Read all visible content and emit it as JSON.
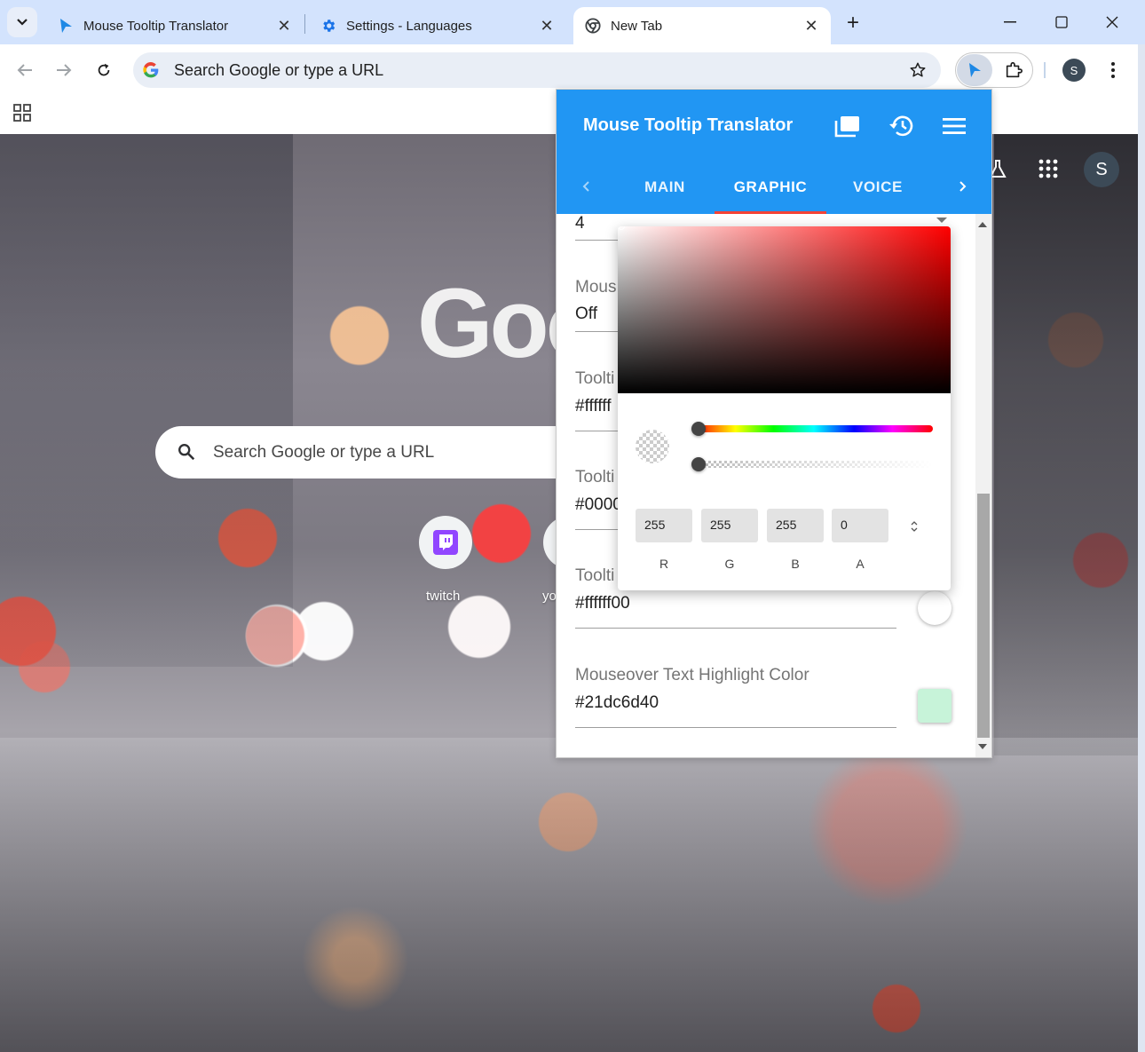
{
  "tabs": [
    {
      "title": "Mouse Tooltip Translator",
      "icon": "extension-cursor-icon"
    },
    {
      "title": "Settings - Languages",
      "icon": "settings-gear-icon"
    },
    {
      "title": "New Tab",
      "icon": "chrome-icon",
      "active": true
    }
  ],
  "omnibox": {
    "text": "Search Google or type a URL"
  },
  "profile": {
    "initial": "S"
  },
  "ntp": {
    "logo_text": "Goo",
    "search_placeholder": "Search Google or type a URL",
    "shortcuts": [
      {
        "label": "twitch"
      },
      {
        "label": "yo"
      }
    ],
    "avatar_initial": "S"
  },
  "popup": {
    "title": "Mouse Tooltip Translator",
    "tabs": [
      "MAIN",
      "GRAPHIC",
      "VOICE"
    ],
    "active_tab": "GRAPHIC",
    "fields": [
      {
        "label": "",
        "value": "4"
      },
      {
        "label": "Mous",
        "value": "Off"
      },
      {
        "label": "Toolti",
        "value": "#ffffff"
      },
      {
        "label": "Toolti",
        "value": "#0000"
      },
      {
        "label": "Toolti",
        "value": "#ffffff00"
      },
      {
        "label": "Mouseover Text Highlight Color",
        "value": "#21dc6d40"
      }
    ],
    "swatch_colors": {
      "tooltip_bg": "#ffffff",
      "highlight": "#c7f3d9"
    }
  },
  "color_picker": {
    "r": "255",
    "g": "255",
    "b": "255",
    "a": "0",
    "labels": {
      "r": "R",
      "g": "G",
      "b": "B",
      "a": "A"
    },
    "hue": 0,
    "alpha": 0
  },
  "colors": {
    "accent": "#2196f3",
    "tab_indicator": "#f44336",
    "tabstrip": "#d3e3fd"
  }
}
